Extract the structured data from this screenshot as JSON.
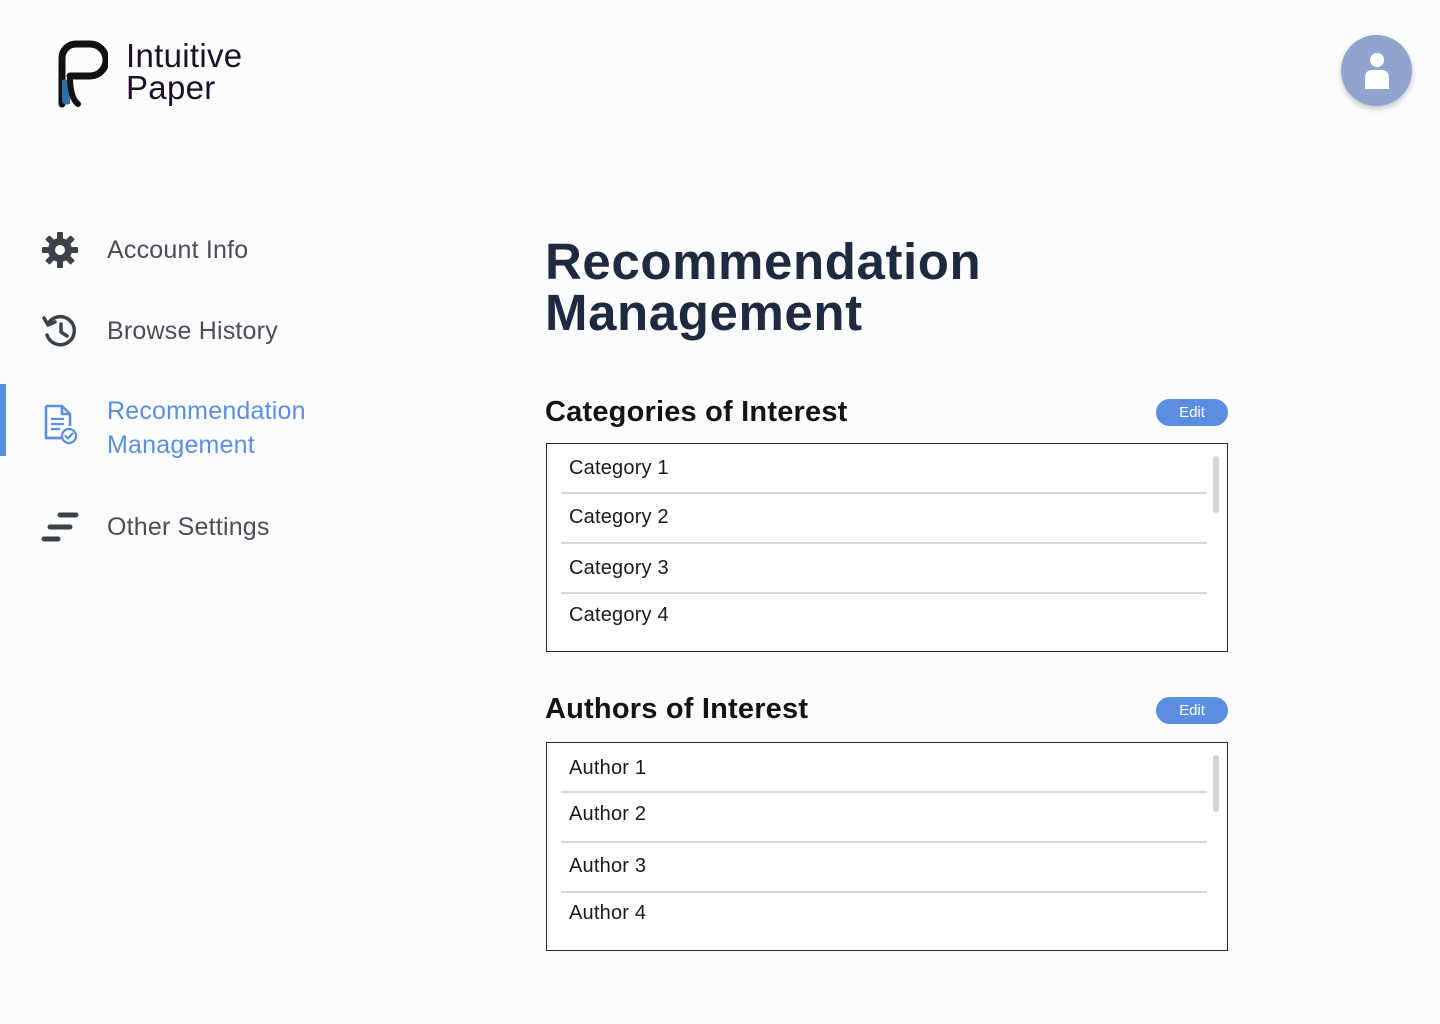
{
  "brand": {
    "name_line1": "Intuitive",
    "name_line2": "Paper",
    "logo_icon": "paper-logo-icon"
  },
  "header": {
    "avatar_icon": "user-avatar-icon"
  },
  "sidebar": {
    "items": [
      {
        "label": "Account Info",
        "icon": "gear-icon",
        "active": false
      },
      {
        "label": "Browse History",
        "icon": "history-icon",
        "active": false
      },
      {
        "label_line1": "Recommendation",
        "label_line2": "Management",
        "icon": "document-check-icon",
        "active": true
      },
      {
        "label": "Other Settings",
        "icon": "settings-lines-icon",
        "active": false
      }
    ]
  },
  "main": {
    "title_line1": "Recommendation",
    "title_line2": "Management",
    "categories": {
      "title": "Categories of Interest",
      "edit_label": "Edit",
      "items": [
        "Category 1",
        "Category 2",
        "Category 3",
        "Category 4"
      ]
    },
    "authors": {
      "title": "Authors of Interest",
      "edit_label": "Edit",
      "items": [
        "Author 1",
        "Author 2",
        "Author 3",
        "Author 4"
      ]
    }
  },
  "colors": {
    "accent": "#5b8ee0",
    "avatar_bg": "#8fa4cf",
    "title": "#1f2a40",
    "nav_text": "#4d4d52"
  }
}
